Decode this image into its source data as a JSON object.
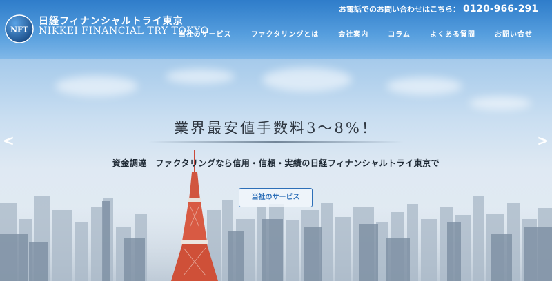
{
  "header": {
    "brand_ja": "日経フィナンシャルトライ東京",
    "brand_en": "NIKKEI FINANCIAL TRY TOKYO",
    "logo_text": "NFT",
    "phone_label": "お電話でのお問い合わせはこちら：",
    "phone_number": "0120-966-291"
  },
  "nav": {
    "items": [
      {
        "label": "当社のサービス"
      },
      {
        "label": "ファクタリングとは"
      },
      {
        "label": "会社案内"
      },
      {
        "label": "コラム"
      },
      {
        "label": "よくある質問"
      },
      {
        "label": "お問い合せ"
      }
    ]
  },
  "hero": {
    "headline": "業界最安値手数料3～8%！",
    "subline": "資金調達　ファクタリングなら信用・信頼・実績の日経フィナンシャルトライ東京で",
    "cta_label": "当社のサービス",
    "prev_arrow": "<",
    "next_arrow": ">"
  },
  "colors": {
    "header_blue": "#2878c8",
    "accent_blue": "#2d6fb8",
    "text_dark": "#2e3640"
  }
}
